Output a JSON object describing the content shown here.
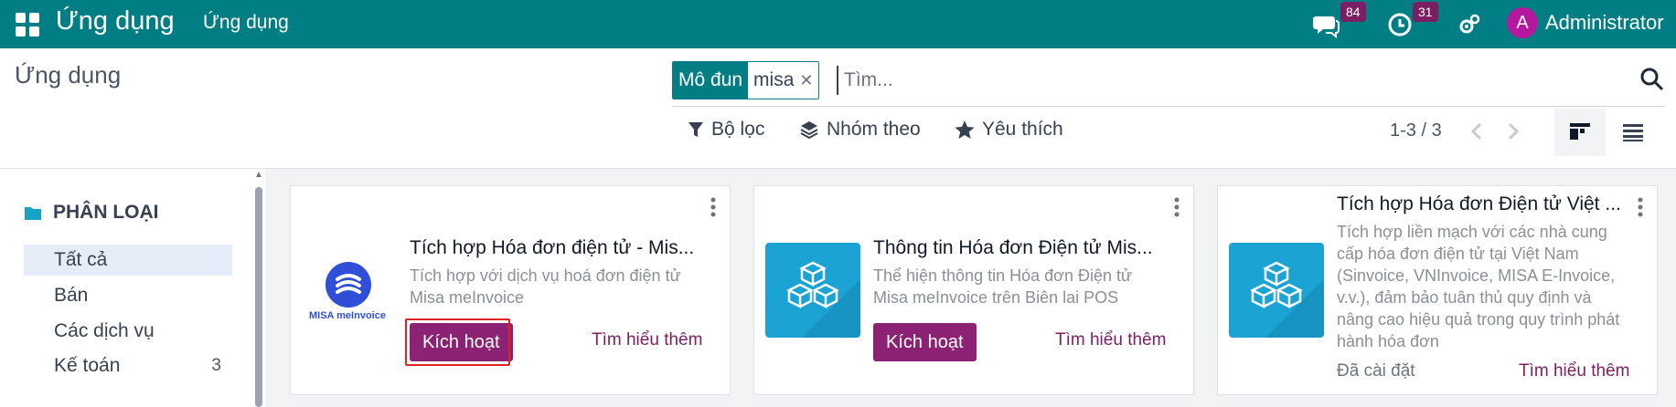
{
  "navbar": {
    "brand": "Ứng dụng",
    "menu": "Ứng dụng",
    "messages_count": "84",
    "activities_count": "31",
    "avatar_letter": "A",
    "username": "Administrator"
  },
  "control_panel": {
    "breadcrumb": "Ứng dụng",
    "facet_label": "Mô đun",
    "facet_value": "misa",
    "search_placeholder": "Tìm...",
    "filter_label": "Bộ lọc",
    "groupby_label": "Nhóm theo",
    "favorites_label": "Yêu thích",
    "pager": "1-3 / 3"
  },
  "sidebar": {
    "title": "PHÂN LOẠI",
    "items": [
      {
        "label": "Tất cả",
        "count": ""
      },
      {
        "label": "Bán",
        "count": ""
      },
      {
        "label": "Các dịch vụ",
        "count": ""
      },
      {
        "label": "Kế toán",
        "count": "3"
      }
    ]
  },
  "cards": [
    {
      "title": "Tích hợp Hóa đơn điện tử - Mis...",
      "desc_line1": "Tích hợp với dịch vụ hoá đơn điện tử",
      "desc_line2": "Misa meInvoice",
      "logo_text": "MISA meInvoice",
      "action_label": "Kích hoạt",
      "learn_more": "Tìm hiểu thêm"
    },
    {
      "title": "Thông tin Hóa đơn Điện tử Mis...",
      "desc_line1": "Thể hiện thông tin Hóa đơn Điện tử",
      "desc_line2": "Misa meInvoice trên Biên lai POS",
      "action_label": "Kích hoạt",
      "learn_more": "Tìm hiểu thêm"
    },
    {
      "title": "Tích hợp Hóa đơn Điện tử Việt ...",
      "desc_lines": [
        "Tích hợp liền mạch với các nhà cung",
        "cấp hóa đơn điện tử tại Việt Nam",
        "(Sinvoice, VNInvoice, MISA E-Invoice,",
        "v.v.), đảm bảo tuân thủ quy định và",
        "nâng cao hiệu quả trong quy trình phát",
        "hành hóa đơn"
      ],
      "status": "Đã cài đặt",
      "learn_more": "Tìm hiểu thêm"
    }
  ],
  "colors": {
    "navbar": "#017e84",
    "primary_button": "#8b2274",
    "link": "#7c1e63",
    "badge": "#7c1e63",
    "highlight": "#e02424"
  }
}
